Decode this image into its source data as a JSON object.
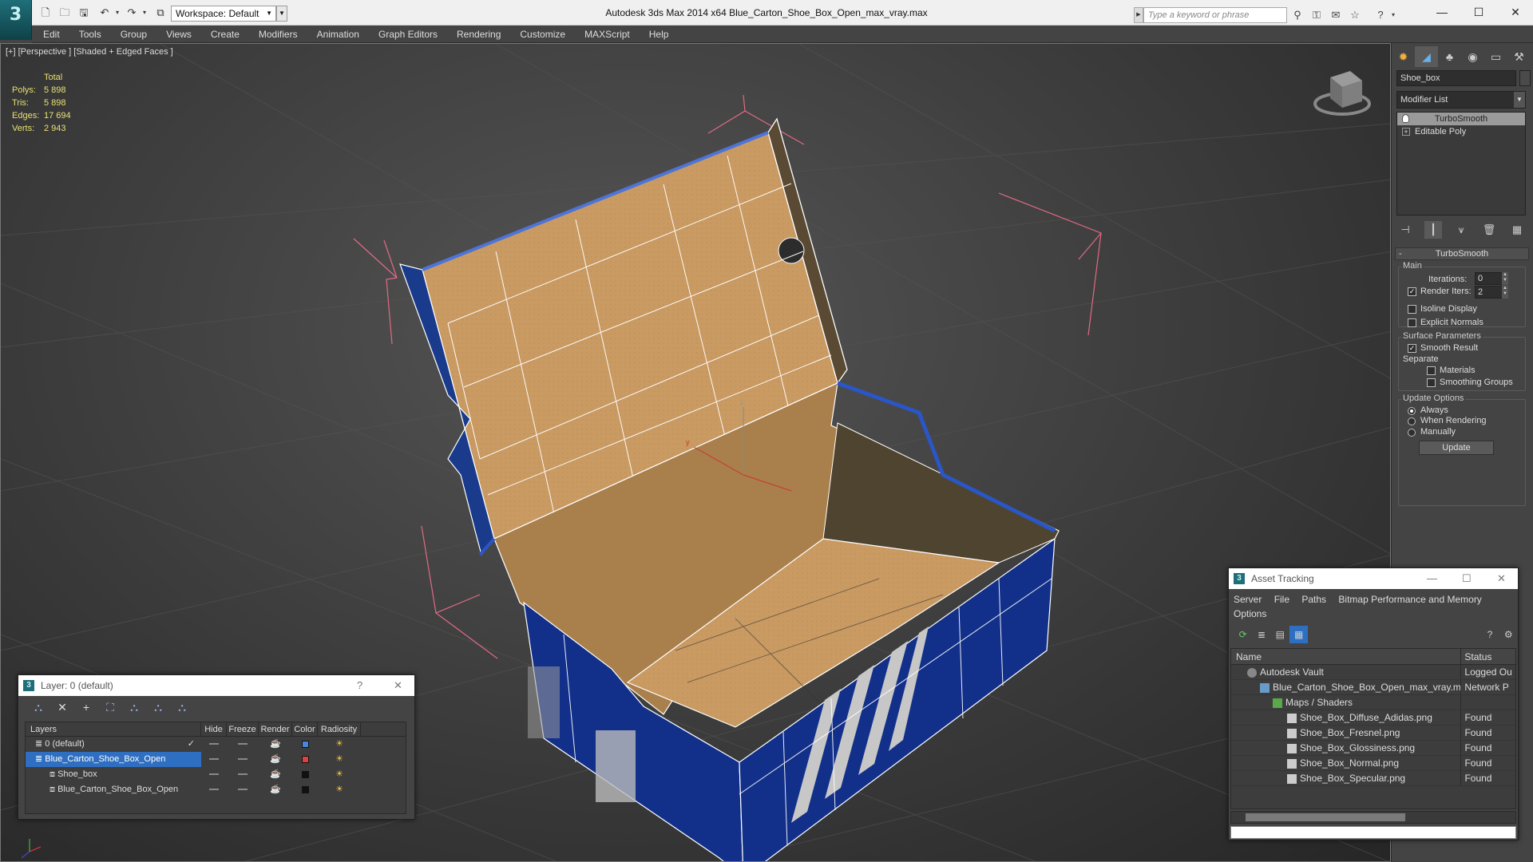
{
  "app": {
    "title": "Autodesk 3ds Max  2014 x64     Blue_Carton_Shoe_Box_Open_max_vray.max",
    "workspace": "Workspace: Default",
    "search_placeholder": "Type a keyword or phrase"
  },
  "menu": [
    "Edit",
    "Tools",
    "Group",
    "Views",
    "Create",
    "Modifiers",
    "Animation",
    "Graph Editors",
    "Rendering",
    "Customize",
    "MAXScript",
    "Help"
  ],
  "viewport": {
    "label": "[+] [Perspective ] [Shaded + Edged Faces ]",
    "stats_header": "Total",
    "stats": [
      {
        "k": "Polys:",
        "v": "5 898"
      },
      {
        "k": "Tris:",
        "v": "5 898"
      },
      {
        "k": "Edges:",
        "v": "17 694"
      },
      {
        "k": "Verts:",
        "v": "2 943"
      }
    ],
    "axis_x": "x",
    "axis_y": "y",
    "axis_z": "z"
  },
  "command_panel": {
    "object_name": "Shoe_box",
    "modifier_list": "Modifier List",
    "stack": [
      "TurboSmooth",
      "Editable Poly"
    ],
    "rollout_title": "TurboSmooth",
    "main_group": "Main",
    "iterations_label": "Iterations:",
    "iterations_value": "0",
    "render_iters_label": "Render Iters:",
    "render_iters_value": "2",
    "isoline_label": "Isoline Display",
    "explicit_normals_label": "Explicit Normals",
    "surface_group": "Surface Parameters",
    "smooth_result_label": "Smooth Result",
    "separate_label": "Separate",
    "materials_label": "Materials",
    "smoothing_groups_label": "Smoothing Groups",
    "update_group": "Update Options",
    "always_label": "Always",
    "when_rendering_label": "When Rendering",
    "manually_label": "Manually",
    "update_button": "Update"
  },
  "layer_dialog": {
    "title": "Layer: 0 (default)",
    "help": "?",
    "columns": [
      "Layers",
      "Hide",
      "Freeze",
      "Render",
      "Color",
      "Radiosity"
    ],
    "rows": [
      {
        "name": "0 (default)",
        "color": "#4a86d9",
        "selected": false
      },
      {
        "name": "Blue_Carton_Shoe_Box_Open",
        "color": "#e04040",
        "selected": true
      },
      {
        "name": "Shoe_box",
        "color": "#111111",
        "selected": false
      },
      {
        "name": "Blue_Carton_Shoe_Box_Open",
        "color": "#111111",
        "selected": false
      }
    ]
  },
  "asset_dialog": {
    "title": "Asset Tracking",
    "menu": [
      "Server",
      "File",
      "Paths",
      "Bitmap Performance and Memory"
    ],
    "menu2": "Options",
    "columns": [
      "Name",
      "Status"
    ],
    "rows": [
      {
        "name": "Autodesk Vault",
        "status": "Logged Ou",
        "indent": 1
      },
      {
        "name": "Blue_Carton_Shoe_Box_Open_max_vray.max",
        "status": "Network P",
        "indent": 2
      },
      {
        "name": "Maps / Shaders",
        "status": "",
        "indent": 3
      },
      {
        "name": "Shoe_Box_Diffuse_Adidas.png",
        "status": "Found",
        "indent": 4
      },
      {
        "name": "Shoe_Box_Fresnel.png",
        "status": "Found",
        "indent": 4
      },
      {
        "name": "Shoe_Box_Glossiness.png",
        "status": "Found",
        "indent": 4
      },
      {
        "name": "Shoe_Box_Normal.png",
        "status": "Found",
        "indent": 4
      },
      {
        "name": "Shoe_Box_Specular.png",
        "status": "Found",
        "indent": 4
      }
    ]
  }
}
